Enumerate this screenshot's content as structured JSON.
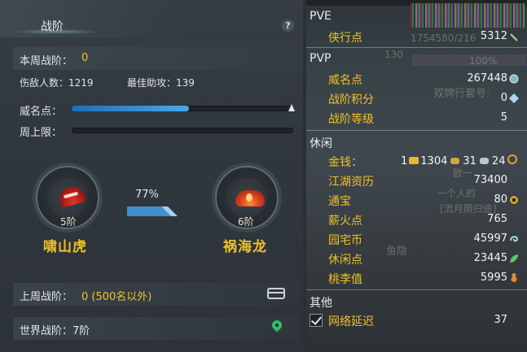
{
  "left_panel": {
    "title": "战阶",
    "help_glyph": "?",
    "weekly_rank_label": "本周战阶：",
    "weekly_rank_value": "0",
    "kills_label": "伤敌人数：1219",
    "assists_label": "最佳助攻：139",
    "prestige_label": "威名点：",
    "weekly_cap_label": "周上限：",
    "prestige_progress": 0.53,
    "weekly_cap_progress": 0.0,
    "current_rank": {
      "tier": "5阶",
      "name": "啸山虎",
      "icon": "fan-icon"
    },
    "next_rank": {
      "tier": "6阶",
      "name": "祸海龙",
      "icon": "crown-icon"
    },
    "progress_percent": "77%",
    "last_week_label": "上周战阶：",
    "last_week_value": "0 (500名以外)",
    "world_rank_label": "世界战阶：7阶"
  },
  "right_panel": {
    "pve": {
      "header": "PVE",
      "items": [
        {
          "label": "侠行点",
          "value": "5312",
          "icon": "sword-icon"
        }
      ]
    },
    "pvp": {
      "header": "PVP",
      "items": [
        {
          "label": "威名点",
          "value": "267448",
          "icon": "medal-icon"
        },
        {
          "label": "战阶积分",
          "value": "0",
          "icon": "crystal-icon"
        },
        {
          "label": "战阶等级",
          "value": "5"
        }
      ]
    },
    "leisure": {
      "header": "休闲",
      "money_label": "金钱：",
      "money_gold_prefix": "1",
      "money_silver": "1304",
      "money_copper": "31",
      "money_coin": "24",
      "items": [
        {
          "label": "江湖资历",
          "value": "73400"
        },
        {
          "label": "通宝",
          "value": "80",
          "icon": "coin-icon"
        },
        {
          "label": "薪火点",
          "value": "765"
        },
        {
          "label": "园宅币",
          "value": "45997",
          "icon": "swirl-icon"
        },
        {
          "label": "休闲点",
          "value": "23445",
          "icon": "leaf-icon"
        },
        {
          "label": "桃李值",
          "value": "5995",
          "icon": "gourd-icon"
        }
      ]
    },
    "other": {
      "header": "其他",
      "items": [
        {
          "label": "网络延迟",
          "value": "37",
          "checked": true
        }
      ]
    },
    "background_text": {
      "line1": "1754580/216",
      "line2": "130",
      "line3": "100%",
      "line4": "双牌行套号:",
      "line5": "欧一",
      "line6": "一个人的",
      "line7": "[流月照归途]",
      "line8": "鱼隐"
    }
  },
  "colors": {
    "accent_gold": "#f0c12a",
    "bar_blue": "#4aa8e8",
    "panel_bg": "#30373e"
  }
}
